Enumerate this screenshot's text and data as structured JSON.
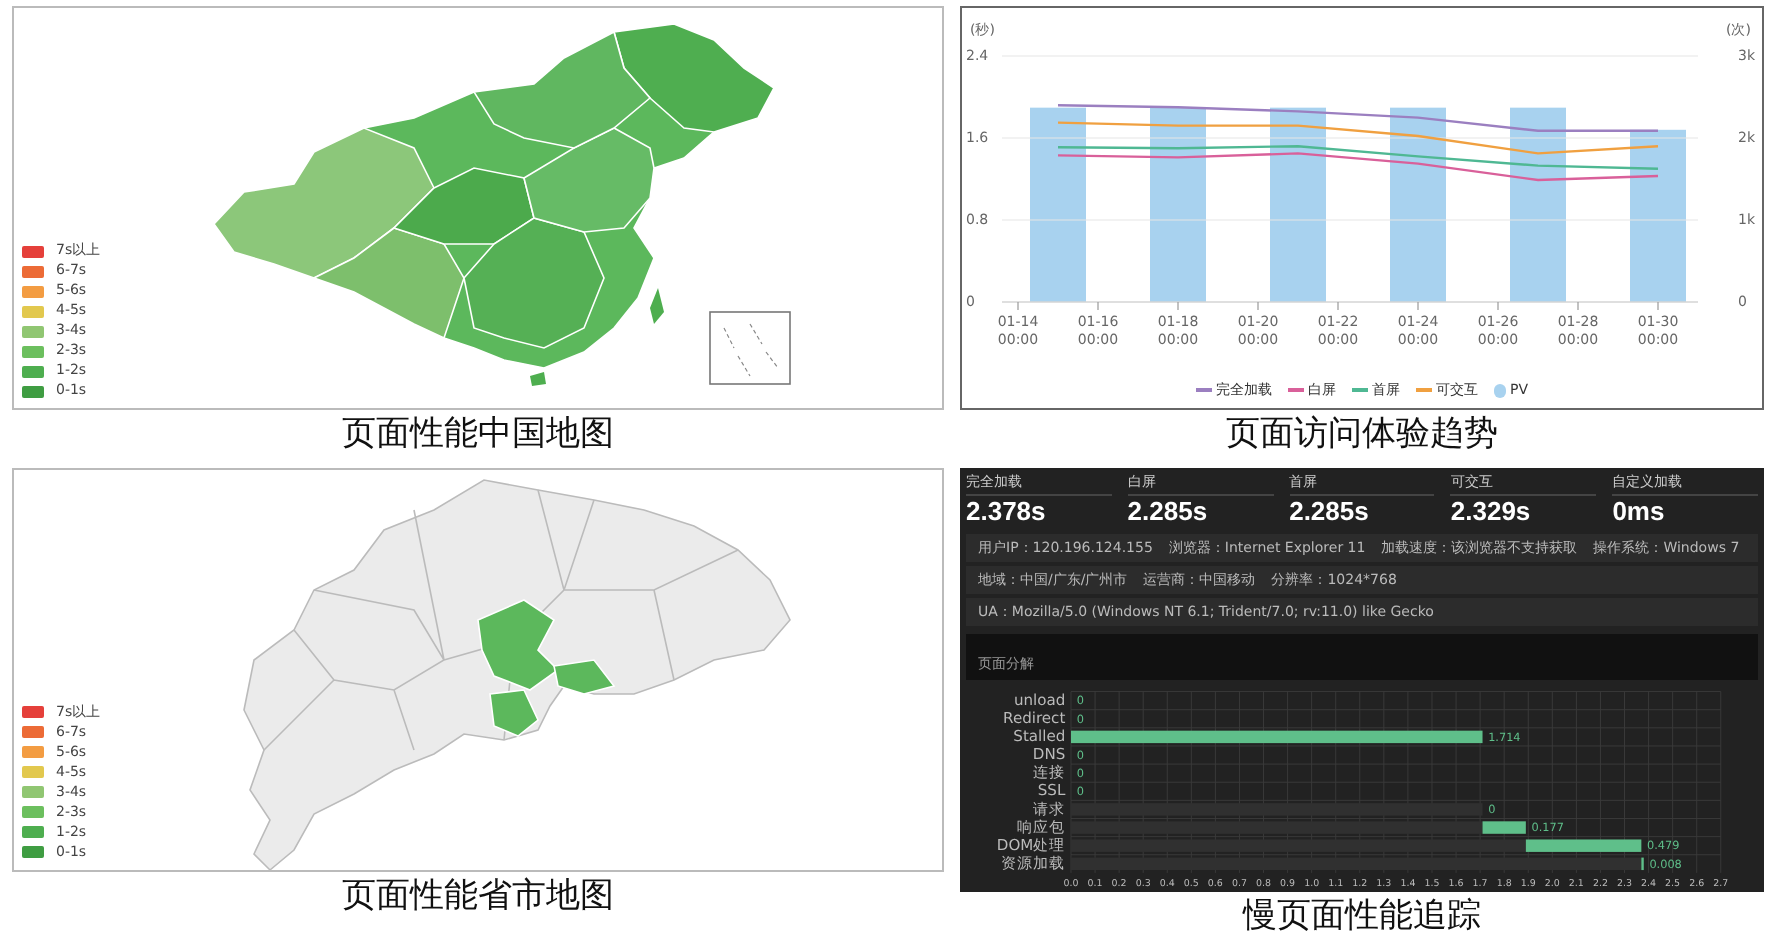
{
  "panels": [
    {
      "kind": "country_map",
      "caption": "页面性能中国地图",
      "legend": [
        {
          "label": "7s以上",
          "color": "#e5403a"
        },
        {
          "label": "6-7s",
          "color": "#ec6b36"
        },
        {
          "label": "5-6s",
          "color": "#f39c42"
        },
        {
          "label": "4-5s",
          "color": "#e2c84e"
        },
        {
          "label": "3-4s",
          "color": "#90c672"
        },
        {
          "label": "2-3s",
          "color": "#6cbf5e"
        },
        {
          "label": "1-2s",
          "color": "#4eae4f"
        },
        {
          "label": "0-1s",
          "color": "#3f9d42"
        }
      ]
    },
    {
      "kind": "trend",
      "caption": "页面访问体验趋势",
      "charts": [
        {
          "chart_data": {
            "type": "line",
            "ylabel": "(秒)",
            "categories": [
              "01-14 00:00",
              null,
              "01-16 00:00",
              null,
              "01-18 00:00",
              null,
              "01-20 00:00",
              null,
              "01-22 00:00",
              null,
              "01-24 00:00",
              null,
              "01-26 00:00",
              null,
              "01-28 00:00",
              null,
              "01-30 00:00"
            ],
            "ylim": [
              0,
              2.4
            ],
            "yticks": [
              {
                "value": 0,
                "label": "0"
              },
              {
                "value": 0.8,
                "label": "0.8"
              },
              {
                "value": 1.6,
                "label": "1.6"
              },
              {
                "value": 2.4,
                "label": "2.4"
              }
            ],
            "series": [
              {
                "name": "完全加载",
                "color": "#9b7fc0",
                "values": [
                  null,
                  1.92,
                  null,
                  null,
                  1.9,
                  null,
                  null,
                  1.86,
                  null,
                  null,
                  1.8,
                  null,
                  null,
                  1.67,
                  null,
                  null,
                  1.67
                ]
              },
              {
                "name": "白屏",
                "color": "#d9609a",
                "values": [
                  null,
                  1.43,
                  null,
                  null,
                  1.41,
                  null,
                  null,
                  1.45,
                  null,
                  null,
                  1.35,
                  null,
                  null,
                  1.19,
                  null,
                  null,
                  1.23
                ]
              },
              {
                "name": "首屏",
                "color": "#4fb893",
                "values": [
                  null,
                  1.51,
                  null,
                  null,
                  1.5,
                  null,
                  null,
                  1.52,
                  null,
                  null,
                  1.42,
                  null,
                  null,
                  1.33,
                  null,
                  null,
                  1.3
                ]
              },
              {
                "name": "可交互",
                "color": "#f0a040",
                "values": [
                  null,
                  1.75,
                  null,
                  null,
                  1.72,
                  null,
                  null,
                  1.72,
                  null,
                  null,
                  1.62,
                  null,
                  null,
                  1.45,
                  null,
                  null,
                  1.52
                ]
              }
            ]
          }
        },
        {
          "chart_data": {
            "type": "bar",
            "ylabel": "(次)",
            "categories": [
              null,
              null,
              null,
              null,
              null,
              null,
              null,
              null,
              null,
              null,
              null,
              null,
              null,
              null,
              null,
              null,
              null
            ],
            "ylim": [
              0,
              3000
            ],
            "yticks": [
              {
                "value": 0,
                "label": "0"
              },
              {
                "value": 1000,
                "label": "1k"
              },
              {
                "value": 2000,
                "label": "2k"
              },
              {
                "value": 3000,
                "label": "3k"
              }
            ],
            "series": [
              {
                "name": "PV",
                "color": "#a8d2ef",
                "values": [
                  null,
                  2370,
                  null,
                  null,
                  2370,
                  null,
                  null,
                  2370,
                  null,
                  null,
                  2370,
                  null,
                  null,
                  2370,
                  null,
                  null,
                  2100
                ]
              }
            ]
          }
        }
      ]
    },
    {
      "kind": "province_map",
      "caption": "页面性能省市地图",
      "legend": [
        {
          "label": "7s以上",
          "color": "#e5403a"
        },
        {
          "label": "6-7s",
          "color": "#ec6b36"
        },
        {
          "label": "5-6s",
          "color": "#f39c42"
        },
        {
          "label": "4-5s",
          "color": "#e2c84e"
        },
        {
          "label": "3-4s",
          "color": "#90c672"
        },
        {
          "label": "2-3s",
          "color": "#6cbf5e"
        },
        {
          "label": "1-2s",
          "color": "#4eae4f"
        },
        {
          "label": "0-1s",
          "color": "#3f9d42"
        }
      ]
    },
    {
      "kind": "trace",
      "caption": "慢页面性能追踪",
      "metrics": [
        {
          "label": "完全加载",
          "value": "2.378s"
        },
        {
          "label": "白屏",
          "value": "2.285s"
        },
        {
          "label": "首屏",
          "value": "2.285s"
        },
        {
          "label": "可交互",
          "value": "2.329s"
        },
        {
          "label": "自定义加载",
          "value": "0ms"
        }
      ],
      "info_rows": [
        [
          "用户IP：120.196.124.155",
          "浏览器：Internet Explorer 11",
          "加载速度：该浏览器不支持获取",
          "操作系统：Windows 7"
        ],
        [
          "地域：中国/广东/广州市",
          "运营商：中国移动",
          "分辨率：1024*768"
        ],
        [
          "UA：Mozilla/5.0 (Windows NT 6.1; Trident/7.0; rv:11.0) like Gecko"
        ]
      ],
      "section_title": "页面分解",
      "chart_data": {
        "type": "bar",
        "orientation": "horizontal",
        "stacked": true,
        "grid": true,
        "categories": [
          "unload",
          "Redirect",
          "Stalled",
          "DNS",
          "连接",
          "SSL",
          "请求",
          "响应包",
          "DOM处理",
          "资源加载"
        ],
        "xlim": [
          0,
          2.7
        ],
        "xticks": [
          {
            "value": 0,
            "label": "0.0"
          },
          {
            "value": 0.1,
            "label": "0.1"
          },
          {
            "value": 0.2,
            "label": "0.2"
          },
          {
            "value": 0.3,
            "label": "0.3"
          },
          {
            "value": 0.4,
            "label": "0.4"
          },
          {
            "value": 0.5,
            "label": "0.5"
          },
          {
            "value": 0.6,
            "label": "0.6"
          },
          {
            "value": 0.7,
            "label": "0.7"
          },
          {
            "value": 0.8,
            "label": "0.8"
          },
          {
            "value": 0.9,
            "label": "0.9"
          },
          {
            "value": 1,
            "label": "1.0"
          },
          {
            "value": 1.1,
            "label": "1.1"
          },
          {
            "value": 1.2,
            "label": "1.2"
          },
          {
            "value": 1.3,
            "label": "1.3"
          },
          {
            "value": 1.4,
            "label": "1.4"
          },
          {
            "value": 1.5,
            "label": "1.5"
          },
          {
            "value": 1.6,
            "label": "1.6"
          },
          {
            "value": 1.7,
            "label": "1.7"
          },
          {
            "value": 1.8,
            "label": "1.8"
          },
          {
            "value": 1.9,
            "label": "1.9"
          },
          {
            "value": 2,
            "label": "2.0"
          },
          {
            "value": 2.1,
            "label": "2.1"
          },
          {
            "value": 2.2,
            "label": "2.2"
          },
          {
            "value": 2.3,
            "label": "2.3"
          },
          {
            "value": 2.4,
            "label": "2.4"
          },
          {
            "value": 2.5,
            "label": "2.5"
          },
          {
            "value": 2.6,
            "label": "2.6"
          },
          {
            "value": 2.7,
            "label": "2.7"
          }
        ],
        "series": [
          {
            "color": "#303030",
            "values": [
              0,
              0,
              0,
              0,
              0,
              0,
              1.71,
              1.71,
              1.89,
              2.37
            ]
          },
          {
            "color": "#5fbf8a",
            "values": [
              0,
              0,
              1.71,
              0,
              0,
              0,
              0,
              0.18,
              0.48,
              0.01
            ]
          }
        ],
        "value_labels": [
          "0",
          "0",
          "1.714",
          "0",
          "0",
          "0",
          "0",
          "0.177",
          "0.479",
          "0.008"
        ]
      }
    }
  ]
}
